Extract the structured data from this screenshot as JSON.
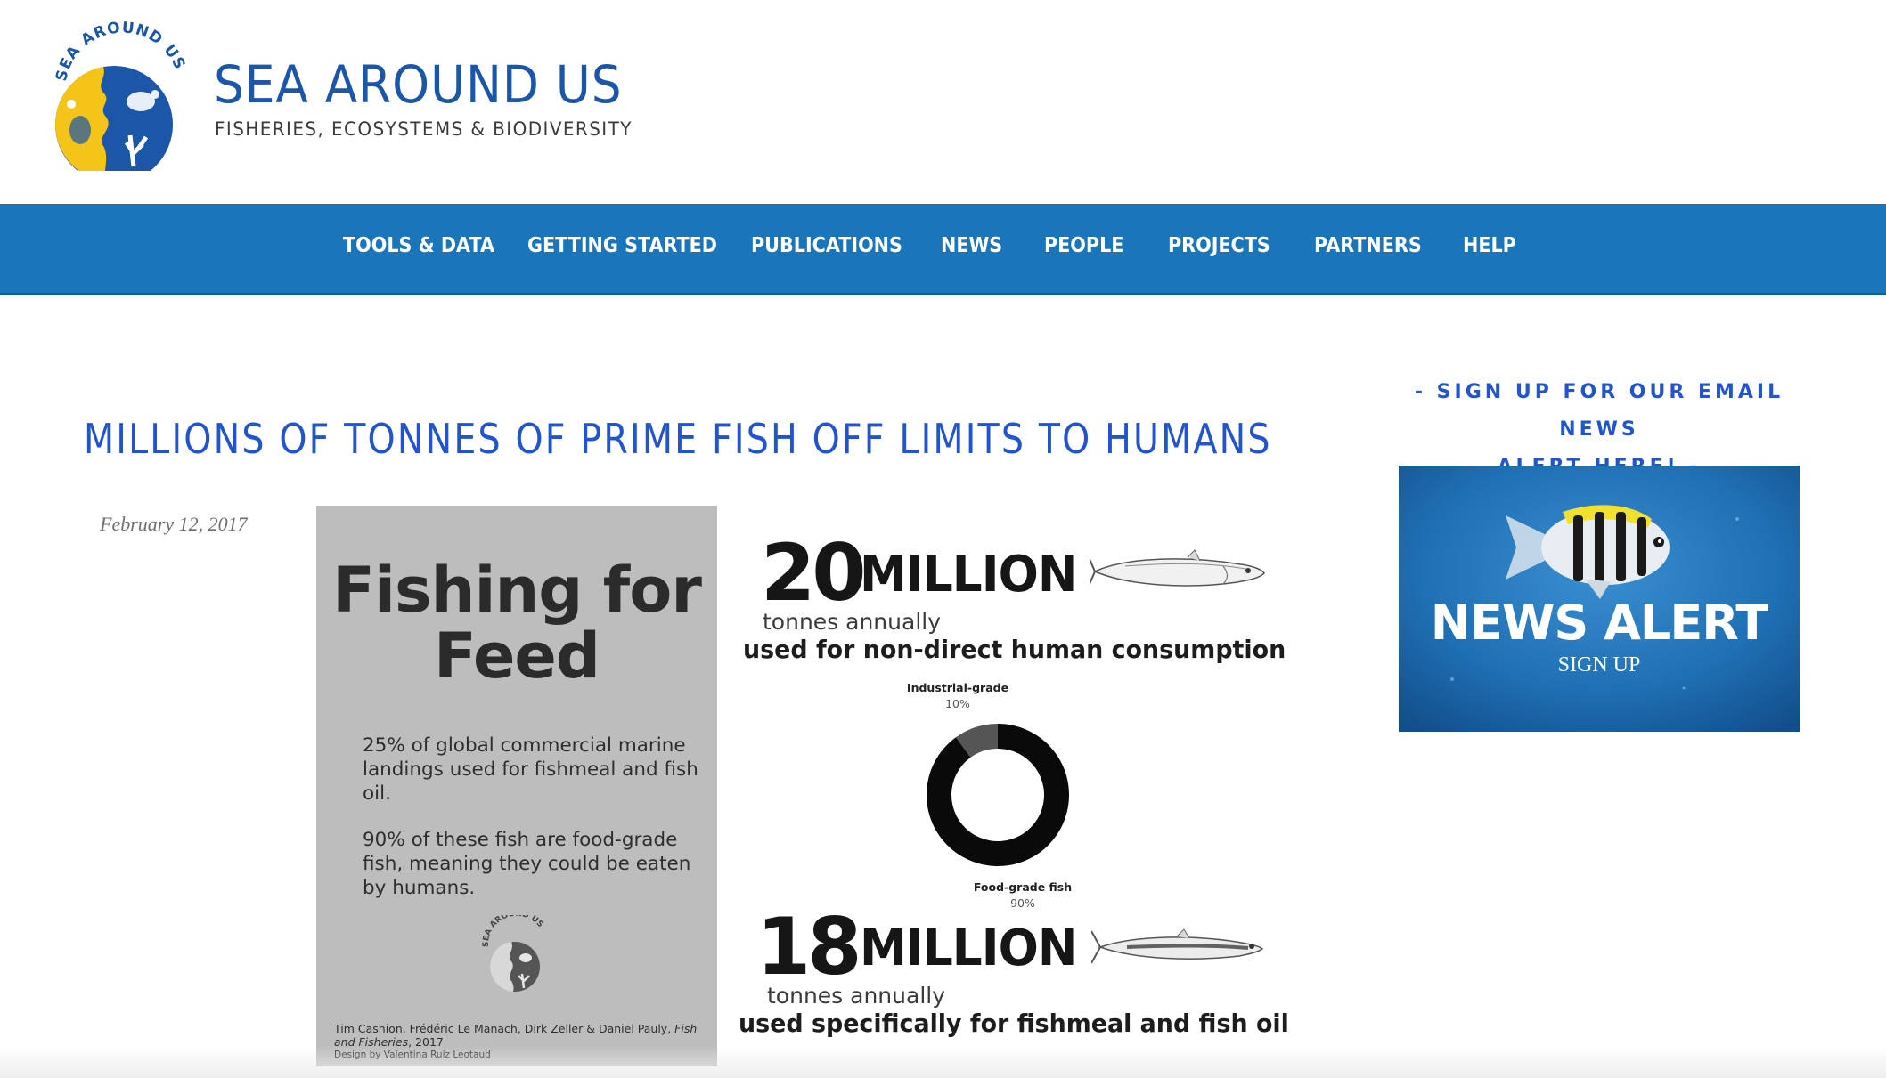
{
  "brand": {
    "logo_ring_text": "SEA AROUND US",
    "name": "SEA AROUND US",
    "tagline": "FISHERIES, ECOSYSTEMS & BIODIVERSITY"
  },
  "nav": {
    "items": [
      {
        "label": "TOOLS & DATA"
      },
      {
        "label": "GETTING STARTED"
      },
      {
        "label": "PUBLICATIONS"
      },
      {
        "label": "NEWS"
      },
      {
        "label": "PEOPLE"
      },
      {
        "label": "PROJECTS"
      },
      {
        "label": "PARTNERS"
      },
      {
        "label": "HELP"
      }
    ]
  },
  "article": {
    "title": "MILLIONS OF TONNES OF PRIME FISH OFF LIMITS TO HUMANS",
    "date": "February 12, 2017"
  },
  "infographic": {
    "panel_title_line1": "Fishing for",
    "panel_title_line2": "Feed",
    "panel_text_1": "25% of global commercial marine landings used for fishmeal and fish oil.",
    "panel_text_2": "90% of these fish are food-grade fish, meaning they could be eaten by humans.",
    "mini_logo_text": "SEA AROUND US",
    "citation_1": "Tim Cashion, Frédéric Le Manach, Dirk Zeller & Daniel Pauly, ",
    "citation_journal": "Fish and Fisheries",
    "citation_2": ", 2017",
    "citation_3": "Design by Valentina Ruiz Leotaud",
    "stat1": {
      "number": "20",
      "unit": "MILLION",
      "sub": "tonnes annually",
      "desc": "used for non-direct human consumption"
    },
    "stat2": {
      "number": "18",
      "unit": "MILLION",
      "sub": "tonnes annually",
      "desc": "used specifically for fishmeal and fish oil"
    },
    "donut": {
      "industrial_label": "Industrial-grade",
      "industrial_pct": "10%",
      "food_label": "Food-grade fish",
      "food_pct": "90%",
      "industrial_value": 10,
      "food_value": 90,
      "colors": {
        "food": "#0a0a0a",
        "industrial": "#555555"
      }
    }
  },
  "sidebar": {
    "signup_line1": "- SIGN UP FOR OUR EMAIL NEWS",
    "signup_line2": "ALERT HERE! -",
    "banner_title": "NEWS ALERT",
    "banner_sub": "SIGN UP"
  },
  "colors": {
    "nav_bg": "#1a75bb",
    "title_blue": "#2255cc",
    "brand_blue": "#1b56a8",
    "logo_yellow": "#f4c418"
  }
}
